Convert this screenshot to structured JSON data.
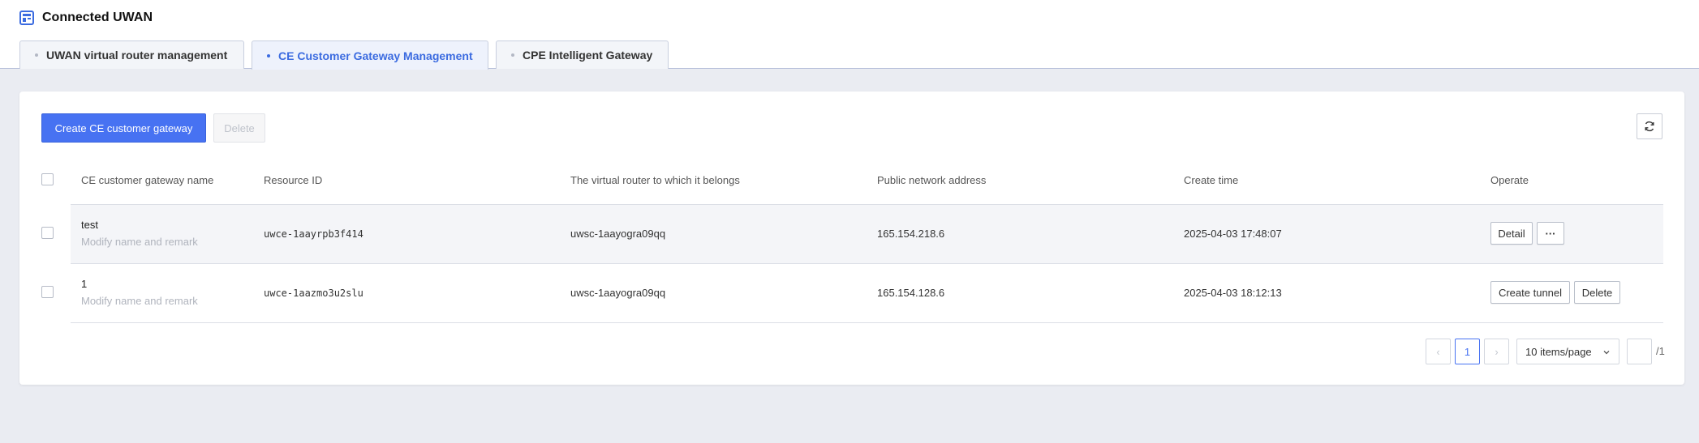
{
  "app": {
    "title": "Connected UWAN",
    "accent_color": "#4772f2"
  },
  "tabs": [
    {
      "label": "UWAN virtual router management",
      "active": false
    },
    {
      "label": "CE Customer Gateway Management",
      "active": true
    },
    {
      "label": "CPE Intelligent Gateway",
      "active": false
    }
  ],
  "toolbar": {
    "create_label": "Create CE customer gateway",
    "delete_label": "Delete",
    "refresh_icon": "refresh-icon"
  },
  "table": {
    "columns": [
      "CE customer gateway name",
      "Resource ID",
      "The virtual router to which it belongs",
      "Public network address",
      "Create time",
      "Operate"
    ],
    "rows": [
      {
        "name": "test",
        "remark": "Modify name and remark",
        "resource_id": "uwce-1aayrpb3f414",
        "router": "uwsc-1aayogra09qq",
        "address": "165.154.218.6",
        "created": "2025-04-03 17:48:07",
        "actions": [
          "Detail",
          "···"
        ]
      },
      {
        "name": "1",
        "remark": "Modify name and remark",
        "resource_id": "uwce-1aazmo3u2slu",
        "router": "uwsc-1aayogra09qq",
        "address": "165.154.128.6",
        "created": "2025-04-03 18:12:13",
        "actions": [
          "Create tunnel",
          "Delete"
        ]
      }
    ]
  },
  "pagination": {
    "prev": "‹",
    "current_page": "1",
    "next": "›",
    "page_size": "10 items/page",
    "jump_value": "",
    "total_pages": "/1"
  }
}
